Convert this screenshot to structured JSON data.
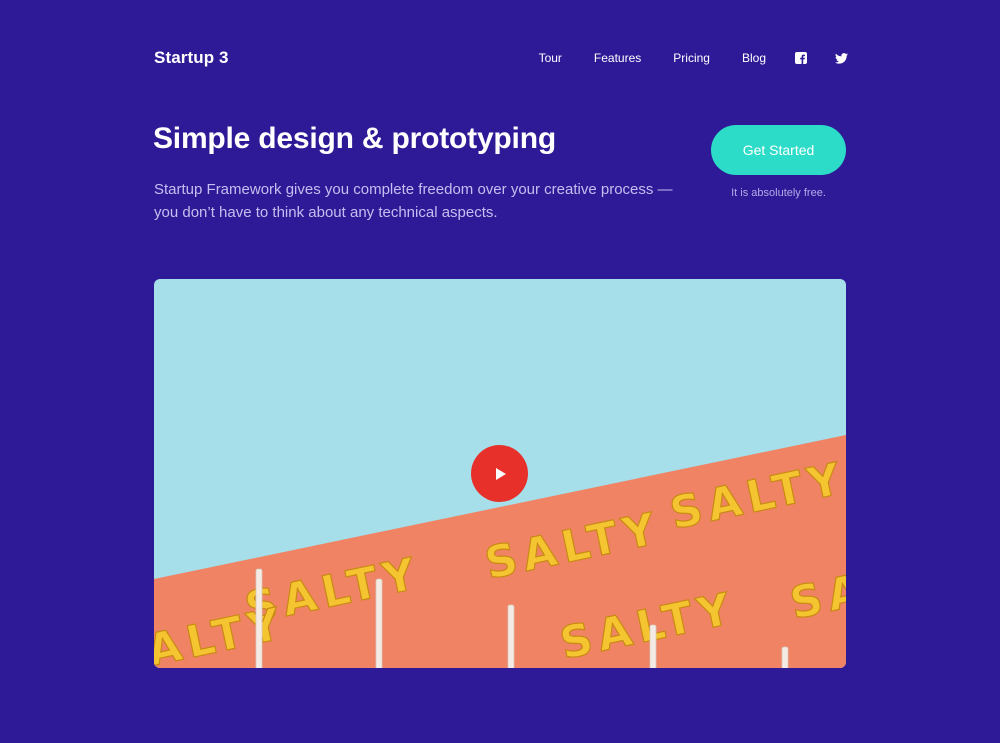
{
  "brand": "Startup 3",
  "nav": {
    "items": [
      "Tour",
      "Features",
      "Pricing",
      "Blog"
    ],
    "social": [
      "facebook-icon",
      "twitter-icon"
    ]
  },
  "hero": {
    "title": "Simple design & prototyping",
    "text": "Startup Framework gives you complete freedom over your creative process — you don’t have to think about any technical aspects.",
    "cta_label": "Get Started",
    "cta_note": "It is absolutely free."
  },
  "media": {
    "word": "SALTY",
    "play_icon": "play-icon"
  },
  "colors": {
    "background": "#2e1a96",
    "accent": "#2ddcc8",
    "sky": "#a6dfe9",
    "wall": "#ef8364",
    "letters": "#f5c531",
    "play": "#e8302a"
  }
}
